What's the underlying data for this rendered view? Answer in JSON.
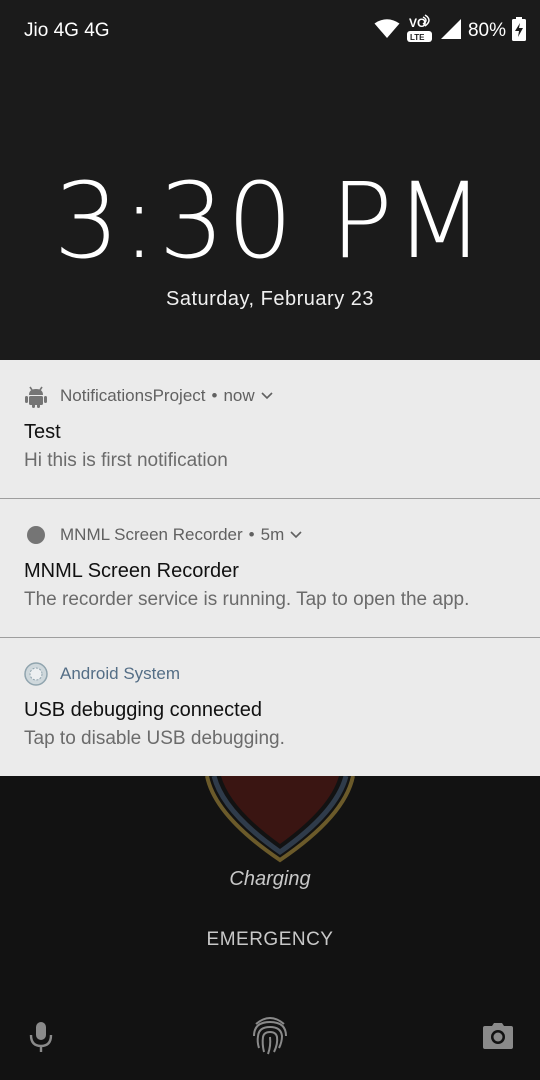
{
  "status_bar": {
    "carrier": "Jio 4G 4G",
    "volte_top": "VO",
    "volte_bottom": "LTE",
    "battery_percent": "80%",
    "icons": [
      "wifi-icon",
      "volte-icon",
      "signal-icon",
      "battery-charging-icon"
    ]
  },
  "lockscreen": {
    "time": "3:30 PM",
    "date": "Saturday, February 23",
    "charging_label": "Charging",
    "emergency_label": "EMERGENCY"
  },
  "notifications": [
    {
      "app_name": "NotificationsProject",
      "separator": "•",
      "time": "now",
      "icon": "android-icon",
      "title": "Test",
      "text": "Hi this is first notification"
    },
    {
      "app_name": "MNML Screen Recorder",
      "separator": "•",
      "time": "5m",
      "icon": "recorder-dot-icon",
      "title": "MNML Screen Recorder",
      "text": "The recorder service is running. Tap to open the app."
    },
    {
      "app_name": "Android System",
      "icon": "android-system-icon",
      "title": "USB debugging connected",
      "text": "Tap to disable USB debugging."
    }
  ],
  "bottom_shortcuts": [
    "microphone-icon",
    "fingerprint-icon",
    "camera-icon"
  ],
  "colors": {
    "background": "#171717",
    "panel": "#ebebeb",
    "system_app_name": "#546e86"
  }
}
